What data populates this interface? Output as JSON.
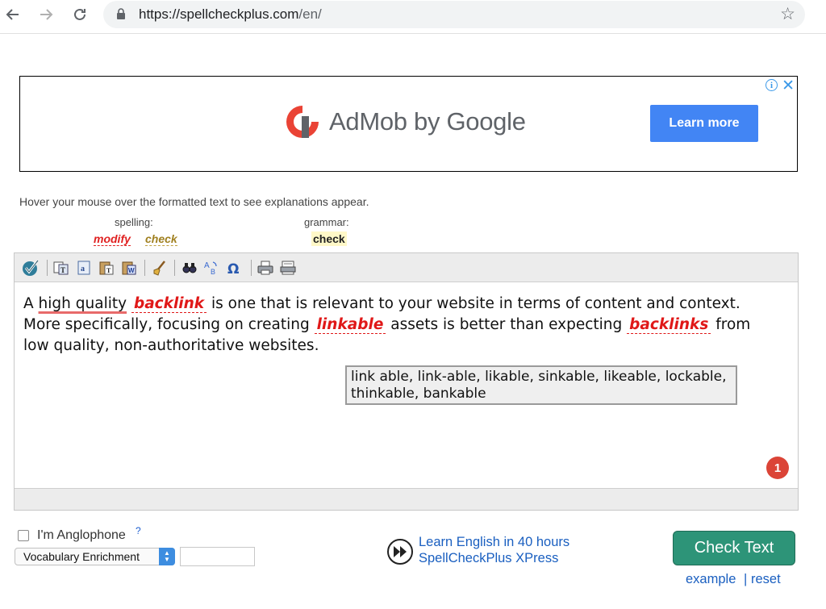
{
  "browser": {
    "url_host": "https://spellcheckplus.com",
    "url_path": "/en/",
    "icons": [
      "back-icon",
      "forward-icon",
      "reload-icon",
      "lock-icon",
      "bookmark-star-icon"
    ]
  },
  "ad": {
    "brand_text": "AdMob by Google",
    "cta_label": "Learn more",
    "info_glyph": "i",
    "close_glyph": "✕",
    "colors": {
      "cta": "#4285f4",
      "logo_red": "#ea4335",
      "logo_dark": "#5f6368"
    }
  },
  "hint": "Hover your mouse over the formatted text to see explanations appear.",
  "legend": {
    "spelling_label": "spelling:",
    "spelling_modify": "modify",
    "spelling_check": "check",
    "grammar_label": "grammar:",
    "grammar_check": "check"
  },
  "toolbar": {
    "icons": [
      "check-icon",
      "copy-text-icon",
      "copy-html-icon",
      "paste-text-icon",
      "paste-word-icon",
      "clear-icon",
      "find-replace-icon",
      "translate-icon",
      "special-characters-icon",
      "print-icon",
      "print-preview-icon"
    ]
  },
  "editor": {
    "sentence1_pre": "A",
    "grammar_error": "high quality",
    "spelling_error1": "backlink",
    "sentence1_post": "is one that is relevant to your website in terms of content and context.",
    "sentence2_pre": "More specifically, focusing on creating",
    "spelling_error2": "linkable",
    "sentence2_mid": "assets is better than expecting",
    "spelling_error3": "backlinks",
    "sentence2_post": "from",
    "sentence3": "low quality, non-authoritative websites.",
    "suggestions": "link able, link-able, likable, sinkable, likeable, lockable, thinkable, bankable",
    "error_count": "1",
    "colors": {
      "spelling_error": "#e01818",
      "grammar_underline": "#e86a6a",
      "badge": "#db4437"
    }
  },
  "controls": {
    "anglophone_label": "I'm Anglophone",
    "anglophone_help": "?",
    "vocab_select_value": "Vocabulary Enrichment",
    "learn_link1": "Learn English in 40 hours",
    "learn_link2": "SpellCheckPlus XPress",
    "check_button": "Check Text",
    "example_link": "example",
    "separator": "|",
    "reset_link": "reset",
    "colors": {
      "check_button": "#2d9478",
      "link": "#1a5fc0"
    }
  }
}
